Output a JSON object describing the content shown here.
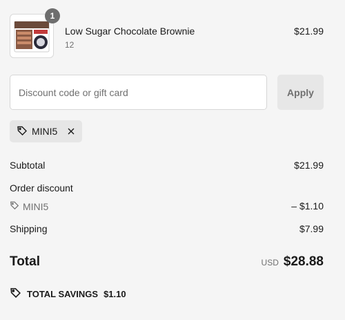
{
  "product": {
    "quantity": "1",
    "name": "Low Sugar Chocolate Brownie",
    "variant": "12",
    "price": "$21.99"
  },
  "discount_form": {
    "placeholder": "Discount code or gift card",
    "apply_label": "Apply"
  },
  "applied_tag": {
    "code": "MINI5"
  },
  "summary": {
    "subtotal_label": "Subtotal",
    "subtotal_value": "$21.99",
    "order_discount_label": "Order discount",
    "discount_code": "MINI5",
    "discount_value": "– $1.10",
    "shipping_label": "Shipping",
    "shipping_value": "$7.99",
    "total_label": "Total",
    "currency": "USD",
    "total_value": "$28.88",
    "savings_label": "TOTAL SAVINGS",
    "savings_value": "$1.10"
  },
  "icons": {
    "tag": "tag-icon",
    "close": "close-icon",
    "savings": "savings-tag-icon"
  }
}
